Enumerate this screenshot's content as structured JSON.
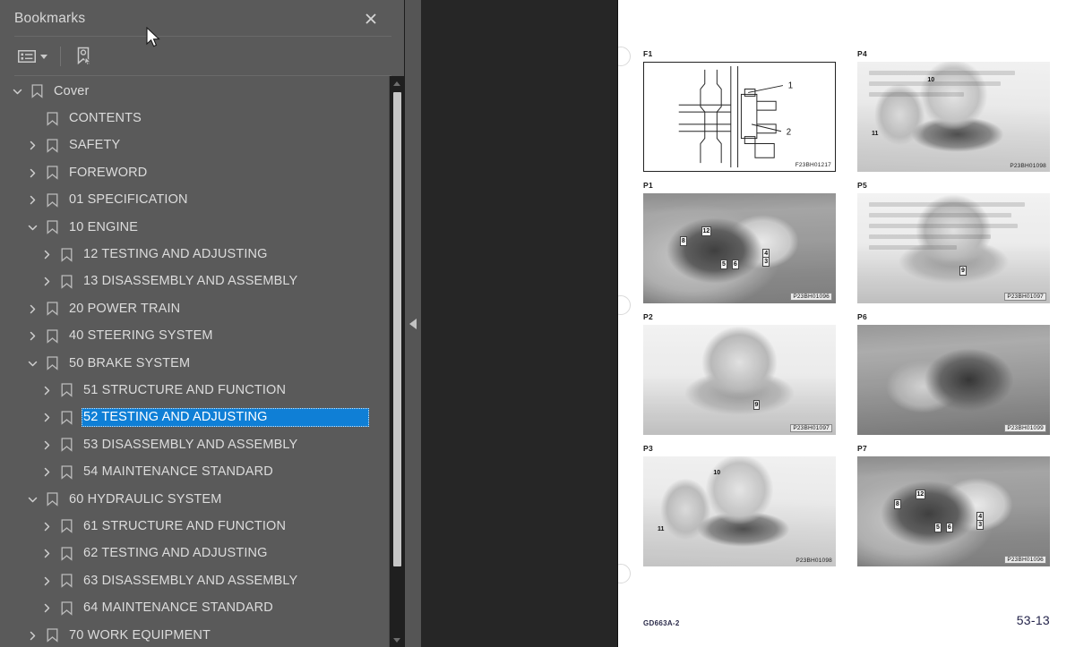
{
  "sidebar": {
    "title": "Bookmarks",
    "close_icon": "close-icon",
    "toolbar": {
      "options_label": "Options",
      "options_icon": "list-options-icon",
      "new_bookmark_label": "New Bookmark",
      "new_bookmark_icon": "new-bookmark-icon"
    },
    "tree": [
      {
        "label": "Cover",
        "level": 0,
        "twisty": "expanded",
        "selected": false
      },
      {
        "label": "CONTENTS",
        "level": 1,
        "twisty": "none",
        "selected": false
      },
      {
        "label": "SAFETY",
        "level": 1,
        "twisty": "collapsed",
        "selected": false
      },
      {
        "label": "FOREWORD",
        "level": 1,
        "twisty": "collapsed",
        "selected": false
      },
      {
        "label": "01 SPECIFICATION",
        "level": 1,
        "twisty": "collapsed",
        "selected": false
      },
      {
        "label": "10 ENGINE",
        "level": 1,
        "twisty": "expanded",
        "selected": false
      },
      {
        "label": "12 TESTING AND ADJUSTING",
        "level": 2,
        "twisty": "collapsed",
        "selected": false
      },
      {
        "label": "13 DISASSEMBLY AND ASSEMBLY",
        "level": 2,
        "twisty": "collapsed",
        "selected": false
      },
      {
        "label": "20 POWER TRAIN",
        "level": 1,
        "twisty": "collapsed",
        "selected": false
      },
      {
        "label": "40 STEERING SYSTEM",
        "level": 1,
        "twisty": "collapsed",
        "selected": false
      },
      {
        "label": "50 BRAKE SYSTEM",
        "level": 1,
        "twisty": "expanded",
        "selected": false
      },
      {
        "label": "51 STRUCTURE AND FUNCTION",
        "level": 2,
        "twisty": "collapsed",
        "selected": false
      },
      {
        "label": "52 TESTING AND ADJUSTING",
        "level": 2,
        "twisty": "collapsed",
        "selected": true
      },
      {
        "label": "53 DISASSEMBLY AND ASSEMBLY",
        "level": 2,
        "twisty": "collapsed",
        "selected": false
      },
      {
        "label": "54 MAINTENANCE STANDARD",
        "level": 2,
        "twisty": "collapsed",
        "selected": false
      },
      {
        "label": "60 HYDRAULIC SYSTEM",
        "level": 1,
        "twisty": "expanded",
        "selected": false
      },
      {
        "label": "61 STRUCTURE AND FUNCTION",
        "level": 2,
        "twisty": "collapsed",
        "selected": false
      },
      {
        "label": "62 TESTING AND ADJUSTING",
        "level": 2,
        "twisty": "collapsed",
        "selected": false
      },
      {
        "label": "63 DISASSEMBLY AND ASSEMBLY",
        "level": 2,
        "twisty": "collapsed",
        "selected": false
      },
      {
        "label": "64 MAINTENANCE STANDARD",
        "level": 2,
        "twisty": "collapsed",
        "selected": false
      },
      {
        "label": "70 WORK EQUIPMENT",
        "level": 1,
        "twisty": "collapsed",
        "selected": false
      }
    ],
    "scrollbar": {
      "up_icon": "scroll-up-arrow-icon",
      "down_icon": "scroll-down-arrow-icon"
    }
  },
  "splitter": {
    "collapse_icon": "collapse-left-arrow-icon"
  },
  "document": {
    "figures": [
      {
        "tag": "F1",
        "code": "F23BH01217",
        "kind": "line-drawing",
        "callouts": [
          "1",
          "2"
        ]
      },
      {
        "tag": "P4",
        "code": "P23BH01098",
        "kind": "photo",
        "callouts": [
          "10",
          "11"
        ]
      },
      {
        "tag": "P1",
        "code": "P23BH01096",
        "kind": "photo",
        "callouts": [
          "12",
          "8",
          "5",
          "6",
          "4",
          "3"
        ]
      },
      {
        "tag": "P5",
        "code": "P23BH01097",
        "kind": "photo",
        "callouts": [
          "9"
        ]
      },
      {
        "tag": "P2",
        "code": "P23BH01097",
        "kind": "photo",
        "callouts": [
          "9"
        ]
      },
      {
        "tag": "P6",
        "code": "P23BH01099",
        "kind": "photo",
        "callouts": []
      },
      {
        "tag": "P3",
        "code": "P23BH01098",
        "kind": "photo",
        "callouts": [
          "10",
          "11"
        ]
      },
      {
        "tag": "P7",
        "code": "P23BH01096",
        "kind": "photo",
        "callouts": [
          "12",
          "8",
          "5",
          "6",
          "4",
          "3"
        ]
      }
    ],
    "footer": {
      "doc_code": "GD663A-2",
      "page_number": "53-13"
    }
  }
}
